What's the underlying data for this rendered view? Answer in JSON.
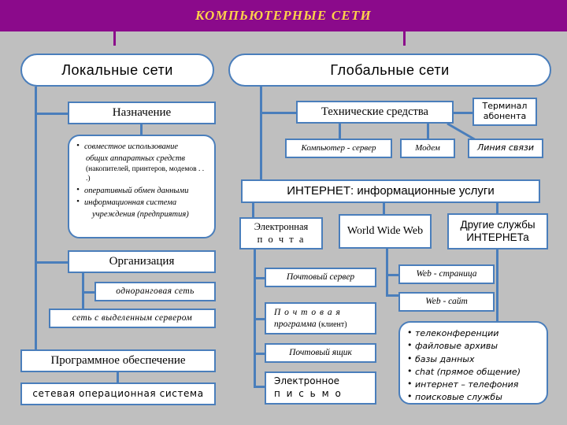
{
  "header": {
    "title": "КОМПЬЮТЕРНЫЕ  СЕТИ",
    "bar_color": "#8B0A8B",
    "text_color": "#FFD24A"
  },
  "theme": {
    "background": "#bfbfbf",
    "box_border": "#4A7EBB",
    "box_fill": "#ffffff",
    "connector": "#4A7EBB"
  },
  "left_branch": {
    "root": "Локальные сети",
    "purpose_title": "Назначение",
    "purpose_items": [
      "совместное   использование",
      "общих  аппаратных  средств",
      "(накопителей, принтеров, модемов . . .)",
      "оперативный  обмен  данными",
      "информационная  система",
      "учреждения (предприятия)"
    ],
    "organization_title": "Организация",
    "organization_items": [
      "одноранговая  сеть",
      "сеть  с  выделенным  сервером"
    ],
    "software_title": "Программное  обеспечение",
    "software_items": [
      "сетевая операционная система"
    ]
  },
  "right_branch": {
    "root": "Глобальные сети",
    "tech_title": "Технические средства",
    "tech_items": [
      "Компьютер - сервер",
      "Модем",
      "Линия  связи"
    ],
    "terminal": "Терминал абонента",
    "terminal_line1": "Терминал",
    "terminal_line2": "абонента",
    "internet_title": "ИНТЕРНЕТ:  информационные  услуги",
    "services": [
      {
        "label": "Электронная п о ч т а",
        "line1": "Электронная",
        "line2": "п о ч т а"
      },
      {
        "label": "World Wide Web",
        "line1": "World Wide Web",
        "line2": ""
      },
      {
        "label": "Другие службы ИНТЕРНЕТа",
        "line1": "Другие службы",
        "line2": "ИНТЕРНЕТа"
      }
    ],
    "email_items": [
      "Почтовый  сервер",
      "П о ч т о в а я",
      "программа",
      "(клиент)",
      "Почтовый  ящик",
      "Электронное",
      "п и с ь м о"
    ],
    "email_box1": "Почтовый  сервер",
    "email_box2_line1": "П о ч т о в а я",
    "email_box2_line2a": "программа",
    "email_box2_line2b": "(клиент)",
    "email_box3": "Почтовый  ящик",
    "email_box4_line1": "Электронное",
    "email_box4_line2": "п и с ь м о",
    "web_items": [
      "Web - страница",
      "Web - сайт"
    ],
    "other_services": [
      "телеконференции",
      "файловые  архивы",
      "базы  данных",
      "chat (прямое общение)",
      "интернет – телефония",
      "поисковые службы"
    ]
  }
}
